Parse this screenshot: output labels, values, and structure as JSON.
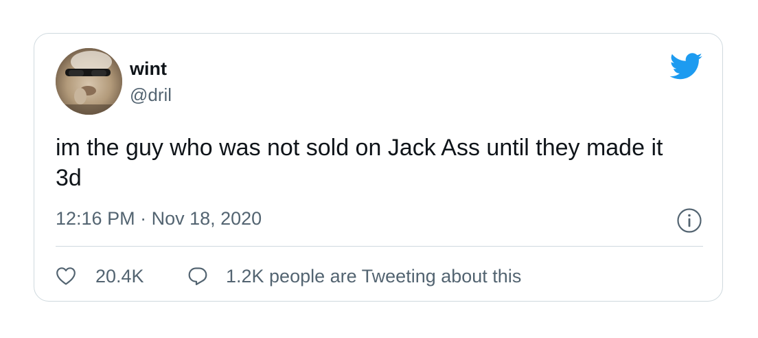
{
  "tweet": {
    "author": {
      "name": "wint",
      "handle": "@dril"
    },
    "text": "im the guy who was not sold on Jack Ass until they made it 3d",
    "time": "12:16 PM",
    "separator": " · ",
    "date": "Nov 18, 2020",
    "likes": "20.4K",
    "conversation": "1.2K people are Tweeting about this"
  },
  "icons": {
    "brand": "twitter-bird-icon",
    "info": "info-icon",
    "like": "heart-icon",
    "reply": "speech-bubble-icon"
  },
  "colors": {
    "brand_blue": "#1d9bf0",
    "text_primary": "#0f1419",
    "text_secondary": "#536471",
    "border": "#cfd9de"
  }
}
